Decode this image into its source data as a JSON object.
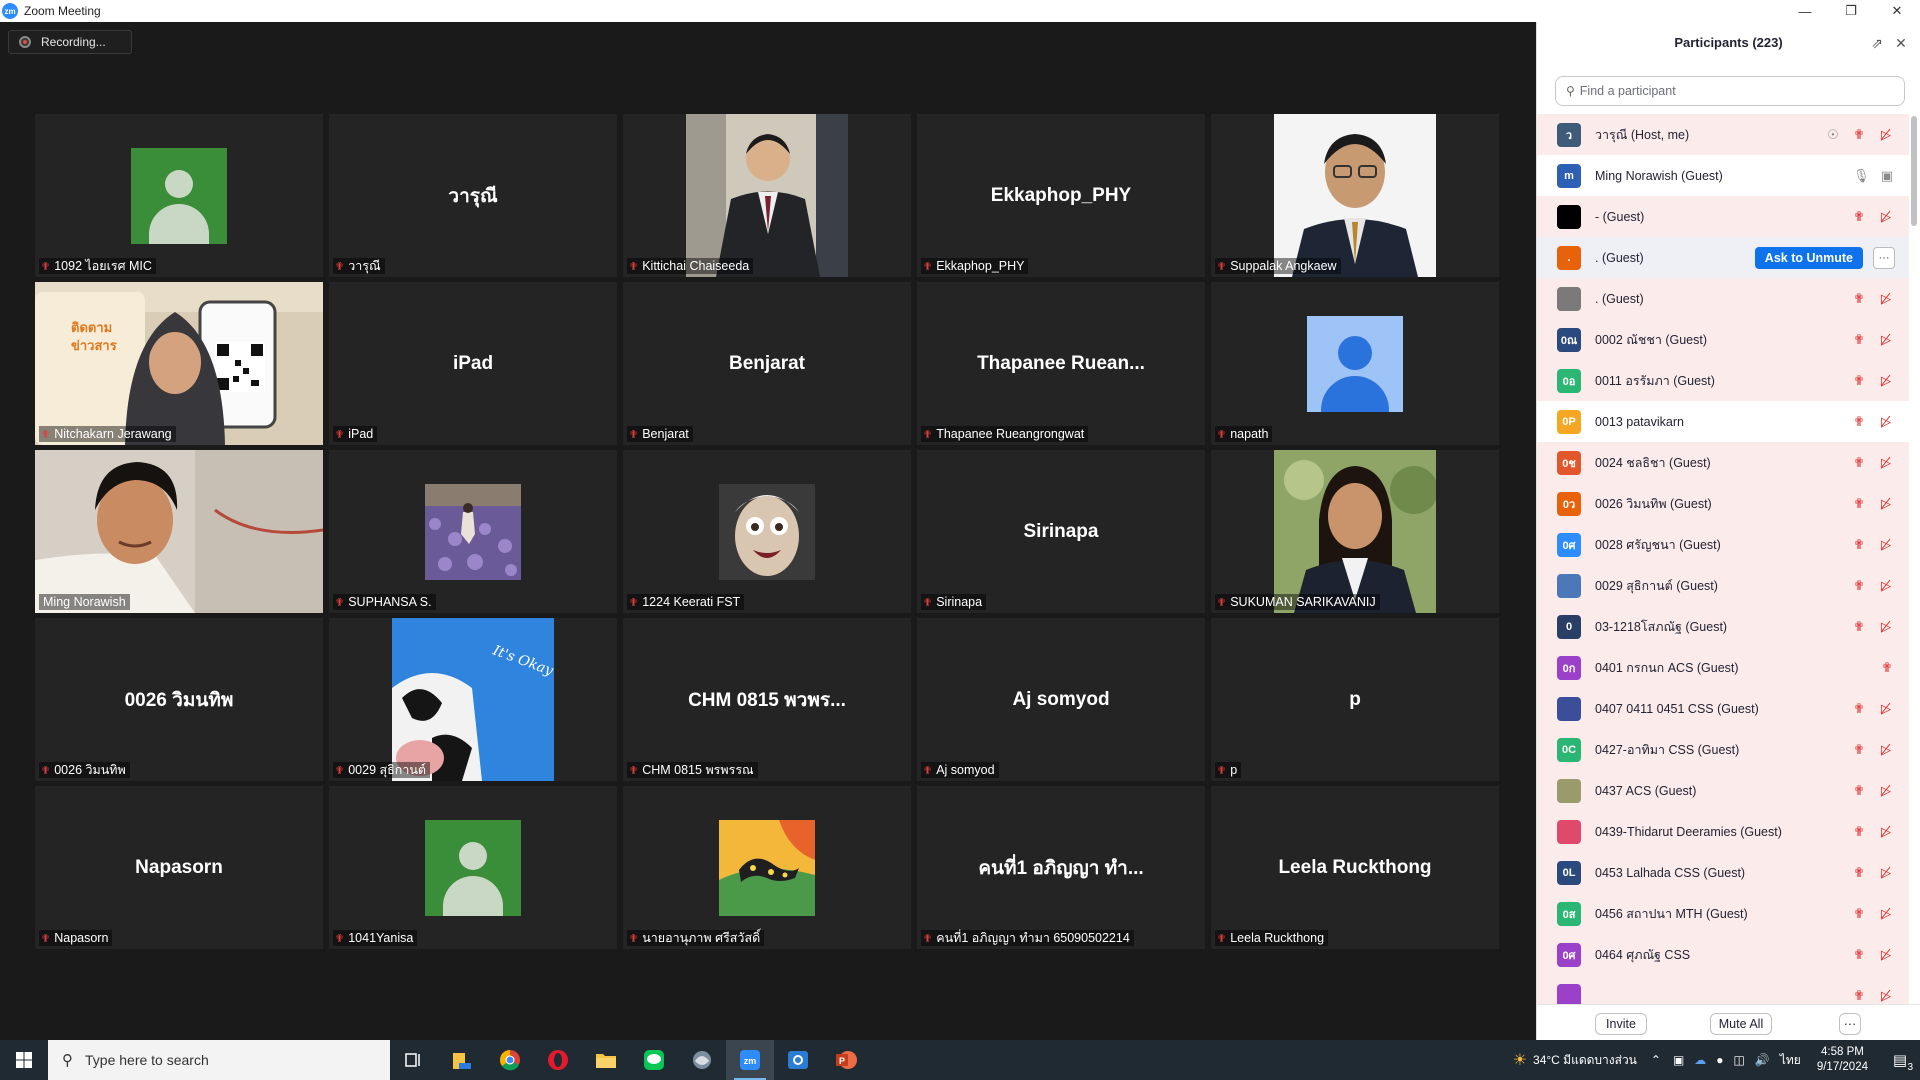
{
  "window": {
    "logo": "zm",
    "title": "Zoom Meeting",
    "controls": [
      "minimize-icon",
      "restore-icon",
      "close-icon"
    ]
  },
  "recording": {
    "label": "Recording..."
  },
  "tiles": [
    {
      "big": "",
      "label": "1092 ไอยเรศ MIC",
      "kind": "avatar-green"
    },
    {
      "big": "วารุณี",
      "label": "วารุณี",
      "kind": "name"
    },
    {
      "big": "",
      "label": "Kittichai Chaiseeda",
      "kind": "photo-suit"
    },
    {
      "big": "Ekkaphop_PHY",
      "label": "Ekkaphop_PHY",
      "kind": "name"
    },
    {
      "big": "",
      "label": "Suppalak Angkaew",
      "kind": "photo-glasses"
    },
    {
      "big": "",
      "label": "Nitchakarn Jerawang",
      "kind": "camera-woman"
    },
    {
      "big": "iPad",
      "label": "iPad",
      "kind": "name"
    },
    {
      "big": "Benjarat",
      "label": "Benjarat",
      "kind": "name"
    },
    {
      "big": "Thapanee  Ruean...",
      "label": "Thapanee Rueangrongwat",
      "kind": "name"
    },
    {
      "big": "",
      "label": "napath",
      "kind": "avatar-blue"
    },
    {
      "big": "",
      "label": "Ming Norawish",
      "kind": "camera-man",
      "active": true
    },
    {
      "big": "",
      "label": "SUPHANSA S.",
      "kind": "photo-flowers"
    },
    {
      "big": "",
      "label": "1224 Keerati FST",
      "kind": "photo-face"
    },
    {
      "big": "Sirinapa",
      "label": "Sirinapa",
      "kind": "name"
    },
    {
      "big": "",
      "label": "SUKUMAN SARIKAVANIJ",
      "kind": "photo-woman"
    },
    {
      "big": "0026 วิมนทิพ",
      "label": "0026 วิมนทิพ",
      "kind": "name"
    },
    {
      "big": "",
      "label": "0029 สุธิกานต์",
      "kind": "photo-cow"
    },
    {
      "big": "CHM 0815 พวพร...",
      "label": "CHM 0815 พรพรรณ",
      "kind": "name"
    },
    {
      "big": "Aj somyod",
      "label": "Aj somyod",
      "kind": "name"
    },
    {
      "big": "p",
      "label": "p",
      "kind": "name"
    },
    {
      "big": "Napasorn",
      "label": "Napasorn",
      "kind": "name"
    },
    {
      "big": "",
      "label": "1041Yanisa",
      "kind": "avatar-green"
    },
    {
      "big": "",
      "label": "นายอานุภาพ ศรีสวัสดิ์",
      "kind": "photo-art"
    },
    {
      "big": "คนที่1 อภิญญา ทำ...",
      "label": "คนที่1 อภิญญา ทำมา 65090502214",
      "kind": "name"
    },
    {
      "big": "Leela Ruckthong",
      "label": "Leela Ruckthong",
      "kind": "name"
    }
  ],
  "panel": {
    "title": "Participants (223)",
    "search_placeholder": "Find a participant",
    "ask_to_unmute": "Ask to Unmute",
    "participants": [
      {
        "initials": "ว",
        "color": "#3e5c7a",
        "name": "วารุณี (Host, me)",
        "state": "host"
      },
      {
        "initials": "m",
        "color": "#2d5fb5",
        "name": "Ming Norawish (Guest)",
        "state": "on"
      },
      {
        "initials": "",
        "color": "#000000",
        "name": "- (Guest)",
        "state": "off"
      },
      {
        "initials": ".",
        "color": "#e8620c",
        "name": ". (Guest)",
        "state": "ask"
      },
      {
        "initials": "",
        "color": "#7a7a7a",
        "name": ". (Guest)",
        "state": "off"
      },
      {
        "initials": "0ณ",
        "color": "#2a4a7e",
        "name": "0002 ณัชชา (Guest)",
        "state": "off"
      },
      {
        "initials": "0อ",
        "color": "#2bb673",
        "name": "0011 อรรัมภา (Guest)",
        "state": "off"
      },
      {
        "initials": "0P",
        "color": "#f5a623",
        "name": "0013 patavikarn",
        "state": "off"
      },
      {
        "initials": "0ช",
        "color": "#e2562b",
        "name": "0024 ชลธิชา (Guest)",
        "state": "off"
      },
      {
        "initials": "0ว",
        "color": "#e8620c",
        "name": "0026 วิมนทิพ (Guest)",
        "state": "off"
      },
      {
        "initials": "0ศ",
        "color": "#2d8cff",
        "name": "0028 ศรัญชนา (Guest)",
        "state": "off"
      },
      {
        "initials": "",
        "color": "#4a78b8",
        "name": "0029 สุธิกานต์ (Guest)",
        "state": "off"
      },
      {
        "initials": "0",
        "color": "#2a3f66",
        "name": "03-1218โสภณัฐ (Guest)",
        "state": "off"
      },
      {
        "initials": "0ก",
        "color": "#9b40c8",
        "name": "0401 กรกนก ACS (Guest)",
        "state": "mic-only"
      },
      {
        "initials": "",
        "color": "#3b4e9a",
        "name": "0407 0411 0451 CSS (Guest)",
        "state": "off"
      },
      {
        "initials": "0C",
        "color": "#2bb673",
        "name": "0427-อาทิมา CSS (Guest)",
        "state": "off"
      },
      {
        "initials": "",
        "color": "#9a9a6a",
        "name": "0437 ACS (Guest)",
        "state": "off"
      },
      {
        "initials": "",
        "color": "#e04a6a",
        "name": "0439-Thidarut Deeramies (Guest)",
        "state": "off"
      },
      {
        "initials": "0L",
        "color": "#2a4a7e",
        "name": "0453 Lalhada CSS (Guest)",
        "state": "off"
      },
      {
        "initials": "0ส",
        "color": "#2bb673",
        "name": "0456 สถาปนา MTH (Guest)",
        "state": "off"
      },
      {
        "initials": "0ศ",
        "color": "#9b40c8",
        "name": "0464 ศุภณัฐ CSS",
        "state": "off"
      },
      {
        "initials": "",
        "color": "#9b40c8",
        "name": "",
        "state": "off"
      }
    ],
    "footer": {
      "invite": "Invite",
      "mute_all": "Mute All",
      "more": "···"
    }
  },
  "taskbar": {
    "search_placeholder": "Type here to search",
    "apps": [
      "task-view-icon",
      "file-explorer-pinned-icon",
      "chrome-icon",
      "opera-icon",
      "folder-icon",
      "line-icon",
      "vpn-icon",
      "zoom-icon",
      "camera-icon",
      "powerpoint-icon"
    ],
    "weather": "34°C  มีแดดบางส่วน",
    "lang": "ไทย",
    "time": "4:58 PM",
    "date": "9/17/2024",
    "notif_count": "3"
  }
}
